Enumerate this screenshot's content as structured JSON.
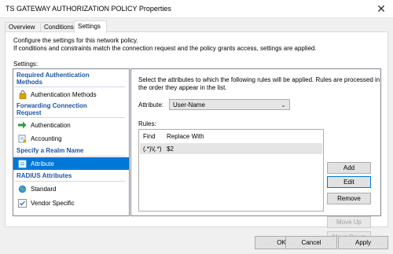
{
  "window": {
    "title": "TS GATEWAY AUTHORIZATION POLICY Properties",
    "close_glyph": "✕"
  },
  "tabs": [
    {
      "label": "Overview"
    },
    {
      "label": "Conditions"
    },
    {
      "label": "Settings",
      "active": true
    }
  ],
  "settings_page": {
    "description_line1": "Configure the settings for this network policy.",
    "description_line2": "If conditions and constraints match the connection request and the policy grants access, settings are applied.",
    "settings_label": "Settings:"
  },
  "left_panel": {
    "categories": [
      {
        "title_line1": "Required Authentication",
        "title_line2": "Methods"
      },
      {
        "title_line1": "Forwarding Connection",
        "title_line2": "Request"
      },
      {
        "title_line1": "Specify a Realm Name",
        "title_line2": ""
      },
      {
        "title_line1": "RADIUS Attributes",
        "title_line2": ""
      }
    ],
    "items": [
      {
        "label": "Authentication Methods",
        "icon": "lock-icon"
      },
      {
        "label": "Authentication",
        "icon": "green-arrow-icon"
      },
      {
        "label": "Accounting",
        "icon": "key-icon"
      },
      {
        "label": "Attribute",
        "icon": "attribute-icon",
        "selected": true
      },
      {
        "label": "Standard",
        "icon": "globe-icon"
      },
      {
        "label": "Vendor Specific",
        "icon": "checkbox-icon"
      }
    ]
  },
  "right_panel": {
    "instruction_line1": "Select the attributes to which the following rules will be applied. Rules are processed in",
    "instruction_line2": "the order they appear in the list.",
    "attribute_label": "Attribute:",
    "attribute_value": "User-Name",
    "rules_label": "Rules:",
    "rules_columns": [
      "Find",
      "Replace With"
    ],
    "rules_rows": [
      {
        "find": "(.*)\\(.*)",
        "replace": "$2"
      }
    ],
    "buttons": {
      "add": "Add",
      "edit": "Edit",
      "remove": "Remove",
      "move_up": "Move Up",
      "move_down": "Move Down"
    }
  },
  "footer": {
    "ok": "OK",
    "cancel": "Cancel",
    "apply": "Apply"
  },
  "colors": {
    "category_text": "#1f55a5",
    "selection": "#0078d7"
  }
}
